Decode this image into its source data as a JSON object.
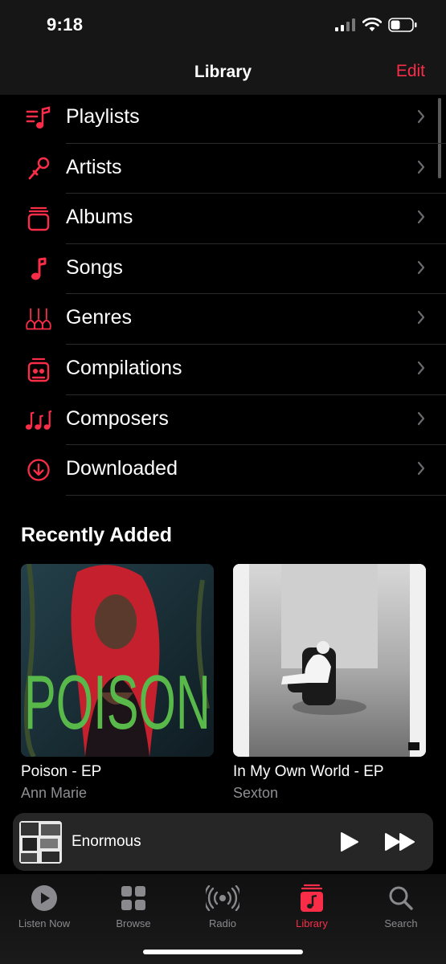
{
  "status_bar": {
    "time": "9:18"
  },
  "nav": {
    "title": "Library",
    "edit_label": "Edit"
  },
  "library_items": [
    {
      "label": "Playlists",
      "icon": "playlist-icon"
    },
    {
      "label": "Artists",
      "icon": "microphone-icon"
    },
    {
      "label": "Albums",
      "icon": "album-icon"
    },
    {
      "label": "Songs",
      "icon": "music-note-icon"
    },
    {
      "label": "Genres",
      "icon": "guitars-icon"
    },
    {
      "label": "Compilations",
      "icon": "compilation-icon"
    },
    {
      "label": "Composers",
      "icon": "music-notes-icon"
    },
    {
      "label": "Downloaded",
      "icon": "download-circle-icon"
    }
  ],
  "recently_added": {
    "title": "Recently Added",
    "albums": [
      {
        "title": "Poison - EP",
        "artist": "Ann Marie",
        "art_text": "POISON"
      },
      {
        "title": "In My Own World - EP",
        "artist": "Sexton"
      }
    ]
  },
  "mini_player": {
    "title": "Enormous"
  },
  "tabs": [
    {
      "label": "Listen Now",
      "icon": "play-circle-icon",
      "active": false
    },
    {
      "label": "Browse",
      "icon": "grid-icon",
      "active": false
    },
    {
      "label": "Radio",
      "icon": "radio-waves-icon",
      "active": false
    },
    {
      "label": "Library",
      "icon": "library-icon",
      "active": true
    },
    {
      "label": "Search",
      "icon": "search-icon",
      "active": false
    }
  ],
  "colors": {
    "accent": "#fa2d48",
    "background": "#000000",
    "secondary_text": "#8e8e93"
  }
}
